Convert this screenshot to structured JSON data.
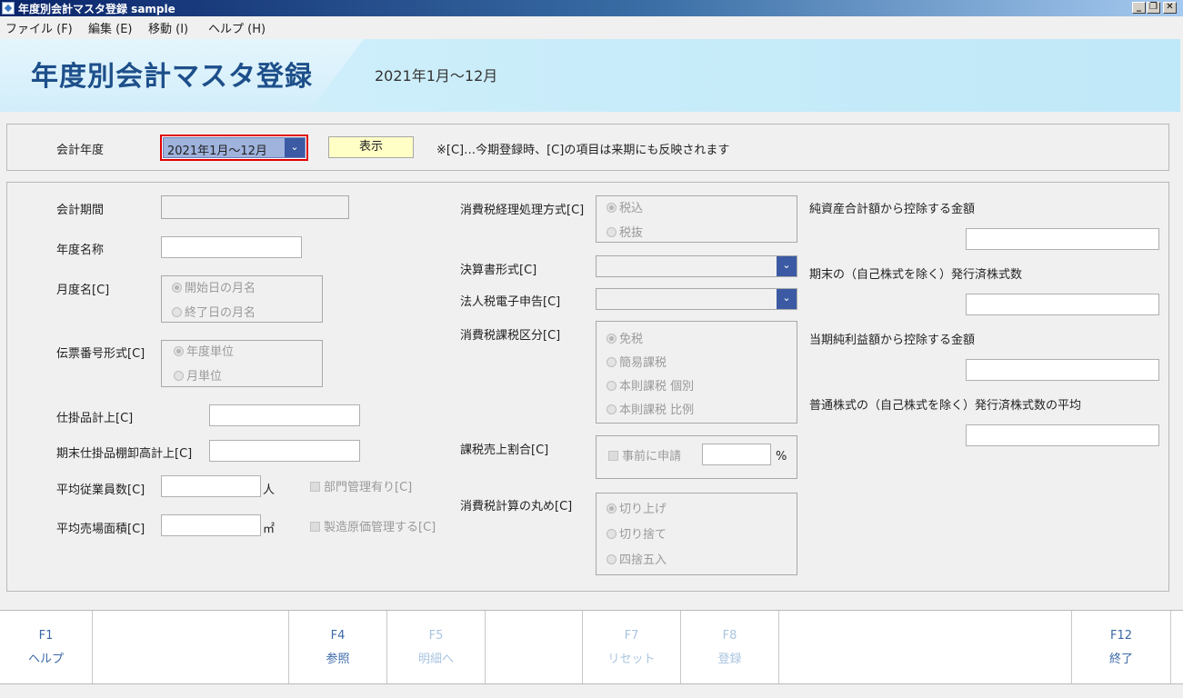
{
  "window": {
    "title": "年度別会計マスタ登録 sample"
  },
  "menu": [
    {
      "label": "ファイル (F)"
    },
    {
      "label": "編集 (E)"
    },
    {
      "label": "移動 (I)"
    },
    {
      "label": "ヘルプ (H)"
    }
  ],
  "header": {
    "title": "年度別会計マスタ登録",
    "period": "2021年1月～12月"
  },
  "filter": {
    "label": "会計年度",
    "selected": "2021年1月～12月",
    "show_button": "表示",
    "note": "※[C]…今期登録時、[C]の項目は来期にも反映されます"
  },
  "left": {
    "period_label": "会計期間",
    "year_name_label": "年度名称",
    "month_name_label": "月度名[C]",
    "month_name_options": [
      "開始日の月名",
      "終了日の月名"
    ],
    "voucher_label": "伝票番号形式[C]",
    "voucher_options": [
      "年度単位",
      "月単位"
    ],
    "wip_label": "仕掛品計上[C]",
    "wip_end_label": "期末仕掛品棚卸高計上[C]",
    "employees_label": "平均従業員数[C]",
    "employees_unit": "人",
    "area_label": "平均売場面積[C]",
    "area_unit": "㎡",
    "dept_check": "部門管理有り[C]",
    "cost_check": "製造原価管理する[C]"
  },
  "middle": {
    "tax_method_label": "消費税経理処理方式[C]",
    "tax_method_options": [
      "税込",
      "税抜"
    ],
    "statement_label": "決算書形式[C]",
    "corp_tax_label": "法人税電子申告[C]",
    "tax_class_label": "消費税課税区分[C]",
    "tax_class_options": [
      "免税",
      "簡易課税",
      "本則課税 個別",
      "本則課税 比例"
    ],
    "ratio_label": "課税売上割合[C]",
    "ratio_check": "事前に申請",
    "ratio_unit": "%",
    "rounding_label": "消費税計算の丸め[C]",
    "rounding_options": [
      "切り上げ",
      "切り捨て",
      "四捨五入"
    ]
  },
  "right": {
    "net_assets_label": "純資産合計額から控除する金額",
    "shares_label": "期末の（自己株式を除く）発行済株式数",
    "net_income_label": "当期純利益額から控除する金額",
    "avg_shares_label": "普通株式の（自己株式を除く）発行済株式数の平均"
  },
  "fkeys": [
    {
      "key": "F1",
      "label": "ヘルプ"
    },
    {
      "key": "F4",
      "label": "参照"
    },
    {
      "key": "F5",
      "label": "明細へ"
    },
    {
      "key": "F7",
      "label": "リセット"
    },
    {
      "key": "F8",
      "label": "登録"
    },
    {
      "key": "F12",
      "label": "終了"
    }
  ]
}
